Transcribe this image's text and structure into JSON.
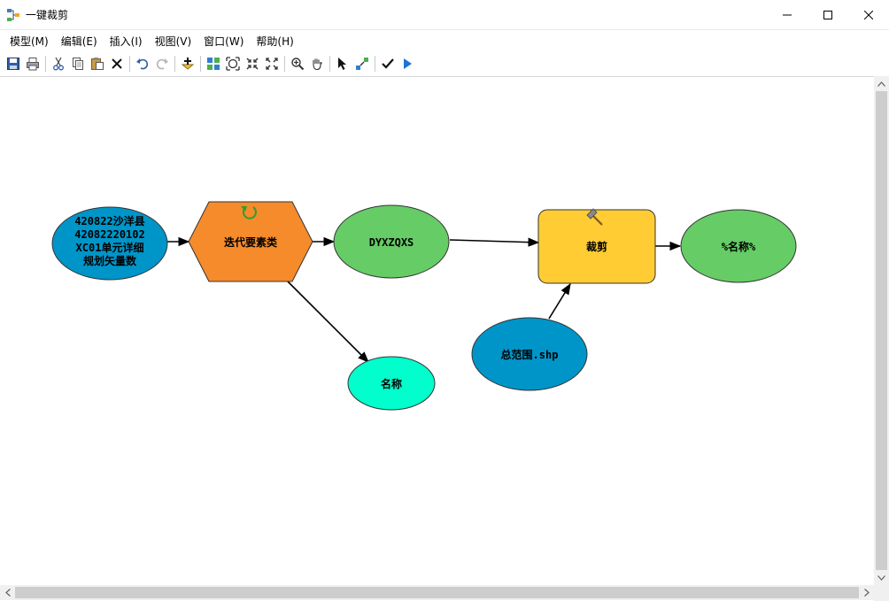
{
  "window": {
    "title": "一键裁剪",
    "controls": {
      "minimize": "minimize-icon",
      "maximize": "maximize-icon",
      "close": "close-icon"
    }
  },
  "menu": [
    {
      "label": "模型(M)"
    },
    {
      "label": "编辑(E)"
    },
    {
      "label": "插入(I)"
    },
    {
      "label": "视图(V)"
    },
    {
      "label": "窗口(W)"
    },
    {
      "label": "帮助(H)"
    }
  ],
  "toolbar": {
    "icons": [
      "save-icon",
      "print-icon",
      "cut-icon",
      "copy-icon",
      "paste-icon",
      "delete-icon",
      "undo-icon",
      "redo-icon",
      "add-data-icon",
      "auto-layout-icon",
      "full-extent-icon",
      "zoom-to-fit-icon",
      "fixed-zoom-out-icon",
      "zoom-in-icon",
      "pan-icon",
      "select-icon",
      "connect-icon",
      "validate-icon",
      "run-icon"
    ]
  },
  "colors": {
    "input_data": "#0095c8",
    "iterator": "#f58b2b",
    "derived_data": "#66cc66",
    "tool": "#ffcc33",
    "value": "#00ffcc",
    "connector": "#000000"
  },
  "model": {
    "input_layer_label": [
      "420822沙洋县",
      "42082220102",
      "XC01单元详细",
      "规划矢量数"
    ],
    "iterator_label": "迭代要素类",
    "iter_output_label": "DYXZQXS",
    "name_value_label": "名称",
    "clip_tool_label": "裁剪",
    "extent_input_label": "总范围.shp",
    "clip_output_label": "%名称%"
  }
}
